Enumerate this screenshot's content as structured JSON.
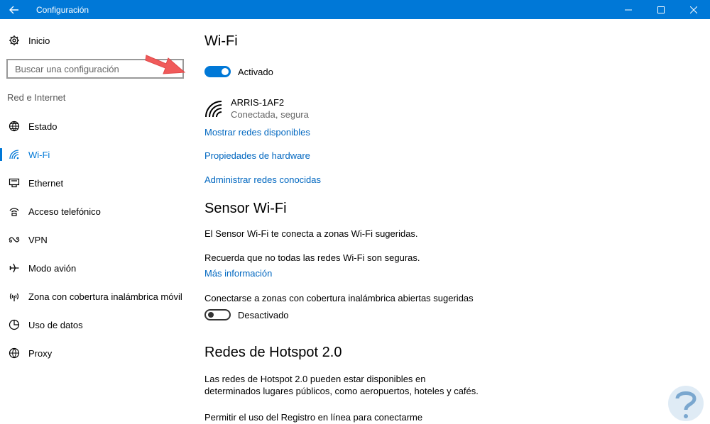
{
  "window": {
    "title": "Configuración"
  },
  "sidebar": {
    "home_label": "Inicio",
    "search_placeholder": "Buscar una configuración",
    "section_label": "Red e Internet",
    "items": [
      {
        "label": "Estado",
        "icon": "globe-icon"
      },
      {
        "label": "Wi-Fi",
        "icon": "wifi-icon",
        "active": true
      },
      {
        "label": "Ethernet",
        "icon": "ethernet-icon"
      },
      {
        "label": "Acceso telefónico",
        "icon": "dialup-icon"
      },
      {
        "label": "VPN",
        "icon": "vpn-icon"
      },
      {
        "label": "Modo avión",
        "icon": "airplane-icon"
      },
      {
        "label": "Zona con cobertura inalámbrica móvil",
        "icon": "hotspot-icon"
      },
      {
        "label": "Uso de datos",
        "icon": "data-usage-icon"
      },
      {
        "label": "Proxy",
        "icon": "proxy-icon"
      }
    ]
  },
  "main": {
    "title": "Wi-Fi",
    "wifi_toggle": {
      "state": "on",
      "label": "Activado"
    },
    "network": {
      "name": "ARRIS-1AF2",
      "status": "Conectada, segura"
    },
    "links": {
      "show_networks": "Mostrar redes disponibles",
      "hardware": "Propiedades de hardware",
      "known": "Administrar redes conocidas"
    },
    "sense": {
      "title": "Sensor Wi-Fi",
      "desc": "El Sensor Wi-Fi te conecta a zonas Wi-Fi sugeridas.",
      "note": "Recuerda que no todas las redes Wi-Fi son seguras.",
      "more_link": "Más información",
      "open_label": "Conectarse a zonas con cobertura inalámbrica abiertas sugeridas",
      "toggle": {
        "state": "off",
        "label": "Desactivado"
      }
    },
    "hotspot": {
      "title": "Redes de Hotspot 2.0",
      "desc_line1": "Las redes de Hotspot 2.0 pueden estar disponibles en",
      "desc_line2": "determinados lugares públicos, como aeropuertos, hoteles y cafés.",
      "online_label": "Permitir el uso del Registro en línea para conectarme"
    }
  },
  "colors": {
    "accent": "#0078d7",
    "link": "#0067c0",
    "annotation_arrow": "#f05a5a"
  }
}
